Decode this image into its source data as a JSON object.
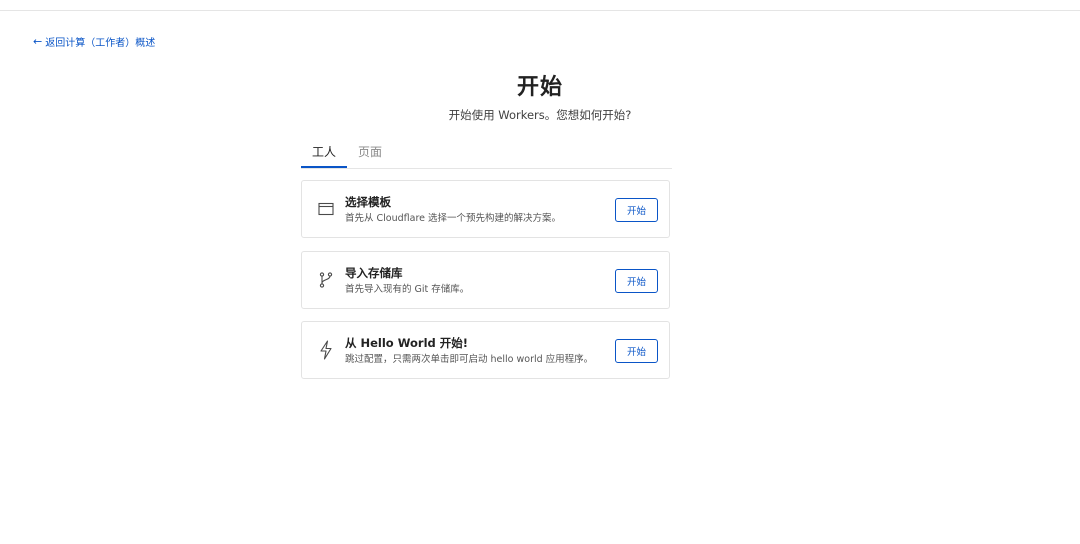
{
  "nav": {
    "back_label": "返回计算（工作者）概述"
  },
  "header": {
    "title": "开始",
    "subtitle": "开始使用 Workers。您想如何开始?"
  },
  "tabs": [
    {
      "label": "工人",
      "active": true
    },
    {
      "label": "页面",
      "active": false
    }
  ],
  "cards": [
    {
      "icon": "browser-window-icon",
      "title": "选择模板",
      "description": "首先从 Cloudflare 选择一个预先构建的解决方案。",
      "button": "开始"
    },
    {
      "icon": "git-branch-icon",
      "title": "导入存储库",
      "description": "首先导入现有的 Git 存储库。",
      "button": "开始"
    },
    {
      "icon": "lightning-bolt-icon",
      "title": "从 Hello World 开始!",
      "description": "跳过配置，只需两次单击即可启动 hello world 应用程序。",
      "button": "开始"
    }
  ],
  "colors": {
    "accent": "#0a55c7",
    "border": "#e3e3e3",
    "text": "#222222"
  }
}
